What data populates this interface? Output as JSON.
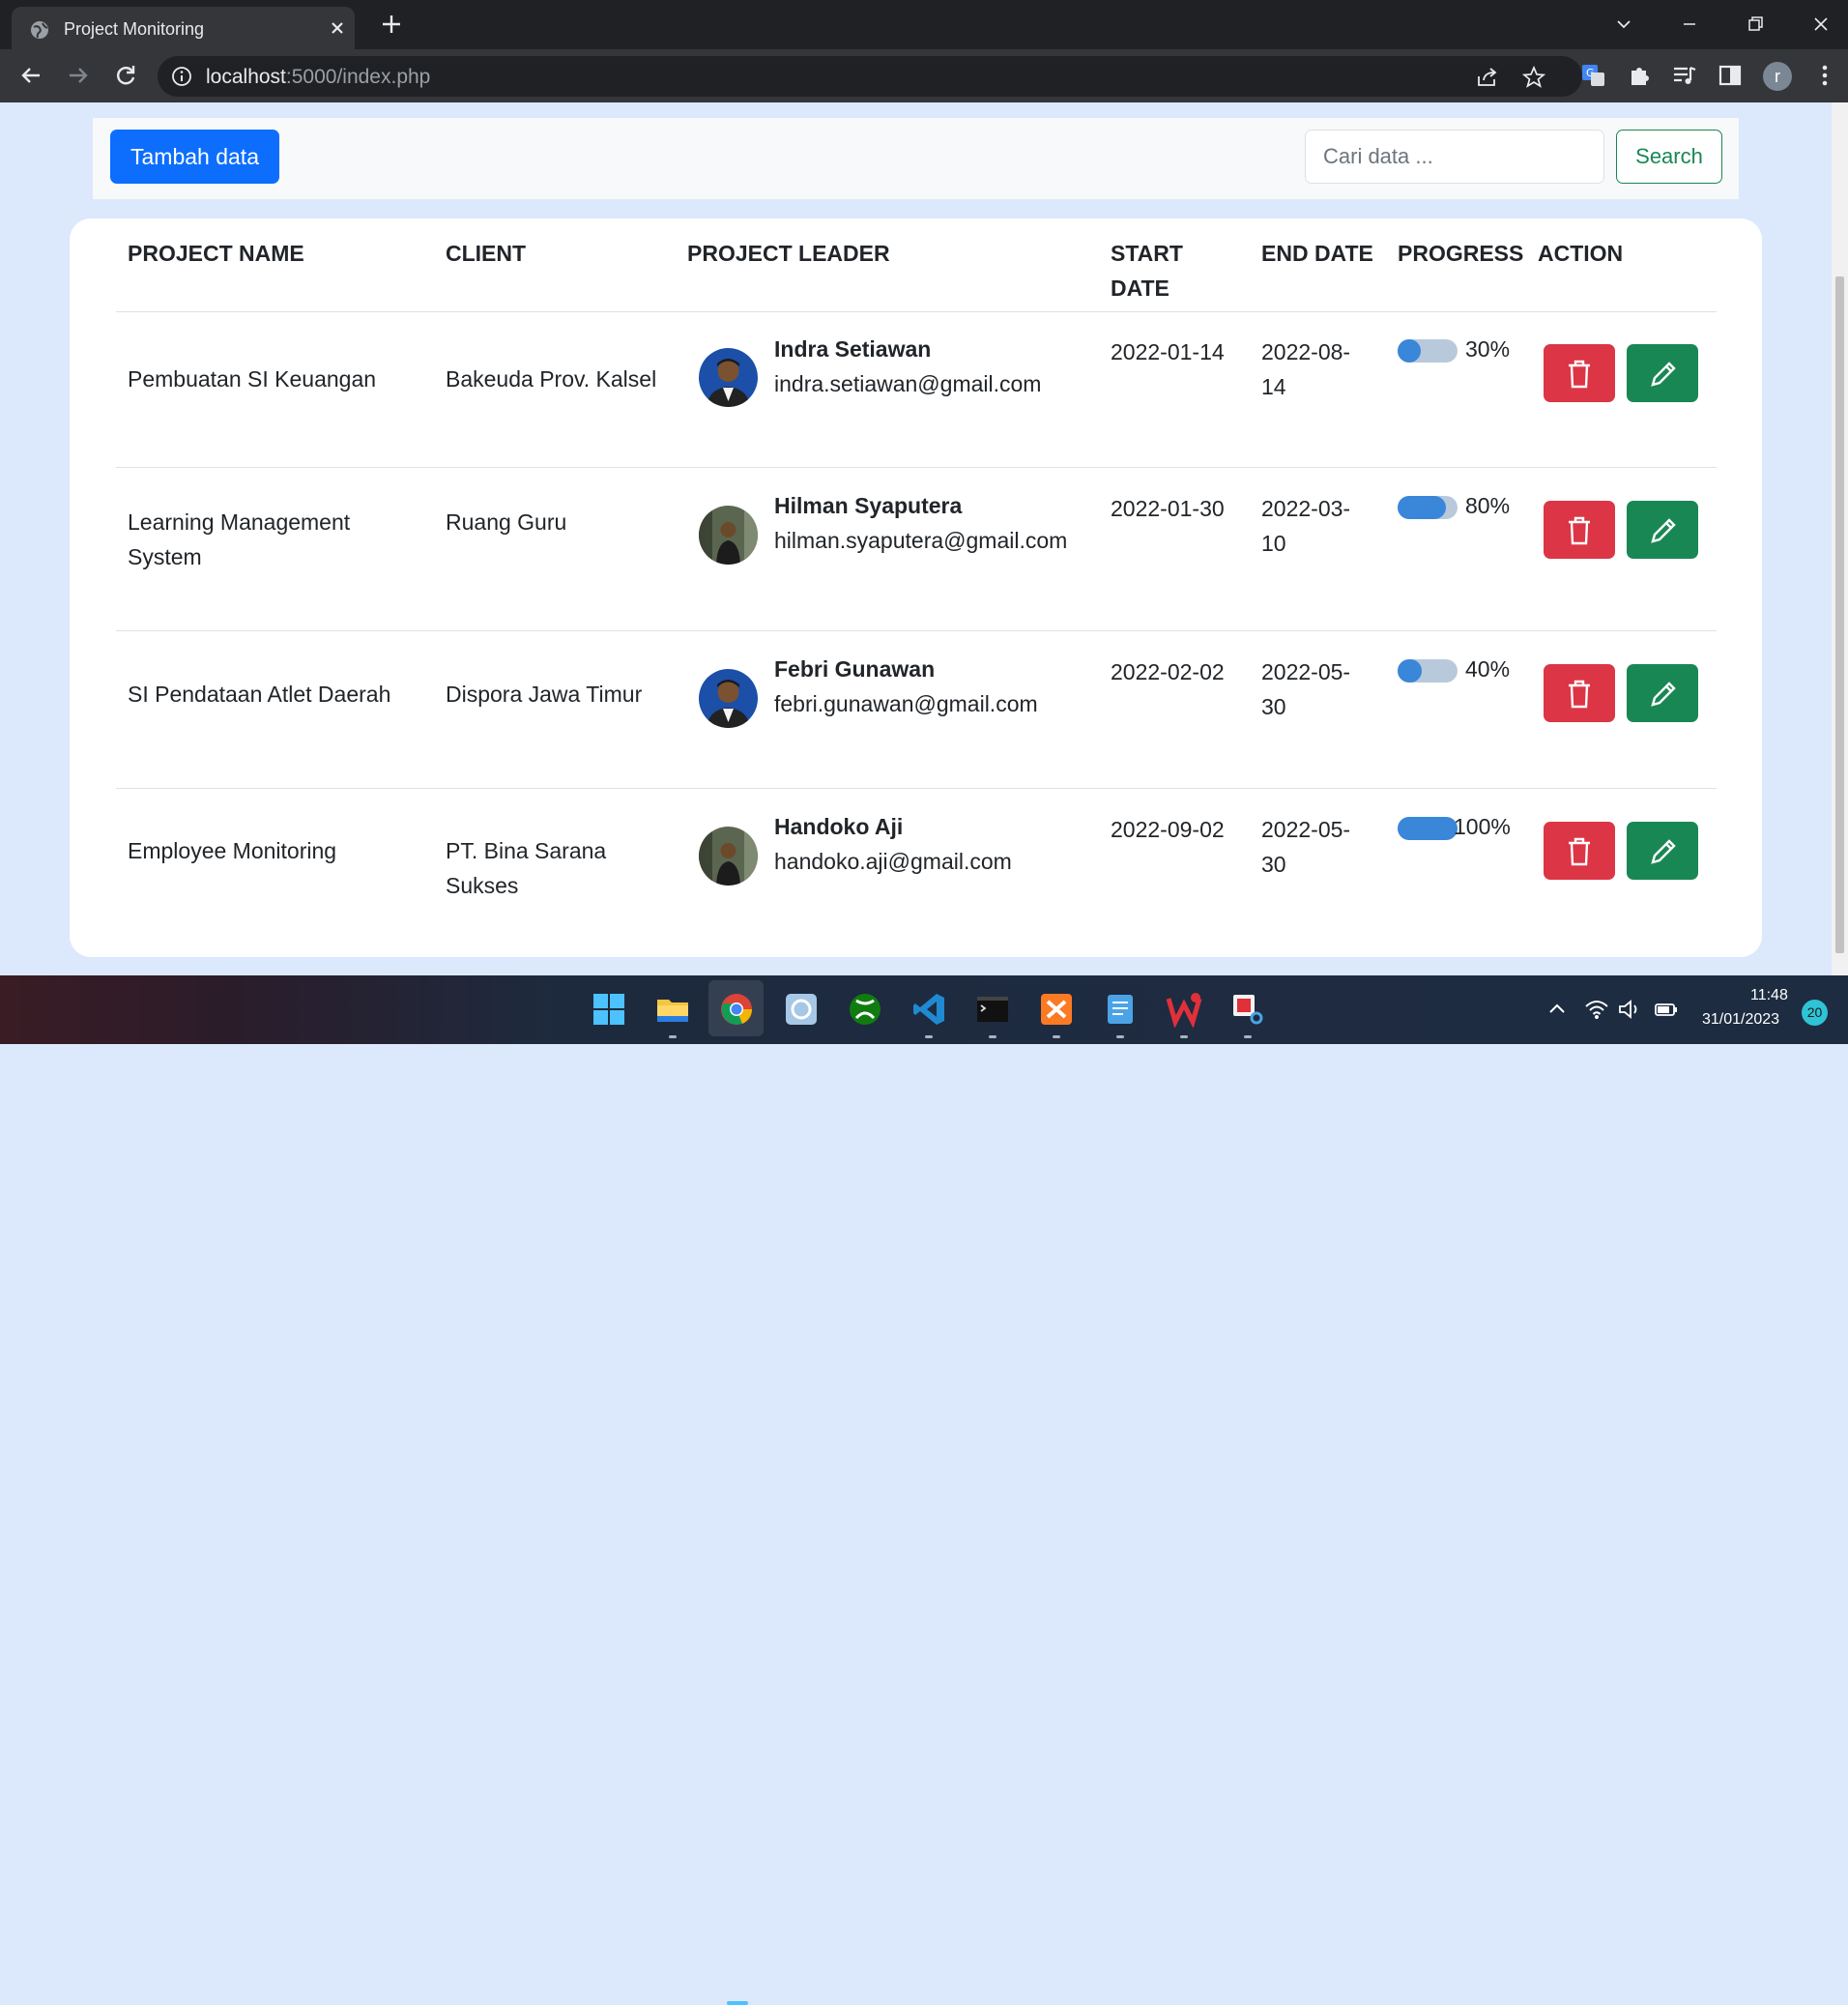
{
  "browser": {
    "tab_title": "Project Monitoring",
    "url_host": "localhost",
    "url_rest": ":5000/index.php",
    "profile_initial": "r"
  },
  "toolbar": {
    "add_label": "Tambah data",
    "search_placeholder": "Cari data ...",
    "search_label": "Search"
  },
  "table": {
    "headers": {
      "project": "PROJECT NAME",
      "client": "CLIENT",
      "leader": "PROJECT LEADER",
      "start_1": "START",
      "start_2": "DATE",
      "end": "END DATE",
      "progress": "PROGRESS",
      "action": "ACTION"
    },
    "rows": [
      {
        "project": "Pembuatan SI Keuangan",
        "client": "Bakeuda Prov. Kalsel",
        "leader": "Indra Setiawan",
        "email": "indra.setiawan@gmail.com",
        "start": "2022-01-14",
        "end_1": "2022-08-",
        "end_2": "14",
        "progress": 30,
        "progress_label": "30%"
      },
      {
        "project_1": "Learning Management",
        "project_2": "System",
        "client": "Ruang Guru",
        "leader": "Hilman Syaputera",
        "email": "hilman.syaputera@gmail.com",
        "start": "2022-01-30",
        "end_1": "2022-03-",
        "end_2": "10",
        "progress": 80,
        "progress_label": "80%"
      },
      {
        "project": "SI Pendataan Atlet Daerah",
        "client": "Dispora Jawa Timur",
        "leader": "Febri Gunawan",
        "email": "febri.gunawan@gmail.com",
        "start": "2022-02-02",
        "end_1": "2022-05-",
        "end_2": "30",
        "progress": 40,
        "progress_label": "40%"
      },
      {
        "project": "Employee Monitoring",
        "client_1": "PT. Bina Sarana",
        "client_2": "Sukses",
        "leader": "Handoko Aji",
        "email": "handoko.aji@gmail.com",
        "start": "2022-09-02",
        "end_1": "2022-05-",
        "end_2": "30",
        "progress": 100,
        "progress_label": "100%"
      }
    ]
  },
  "taskbar": {
    "time": "11:48",
    "date": "31/01/2023",
    "notifications": "20"
  },
  "colors": {
    "primary": "#0d6efd",
    "danger": "#dc3545",
    "success": "#198754",
    "progress": "#3a86d9"
  }
}
